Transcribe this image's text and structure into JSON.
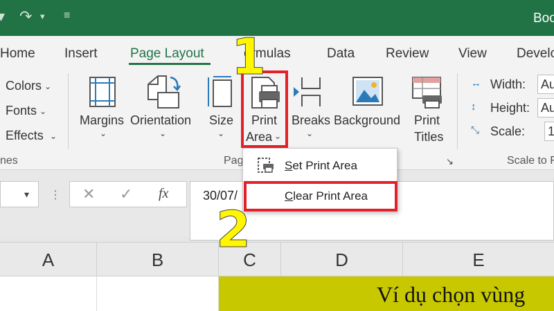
{
  "window": {
    "title": "Boo"
  },
  "tabs": [
    {
      "label": "Home"
    },
    {
      "label": "Insert"
    },
    {
      "label": "Page Layout"
    },
    {
      "label": "ormulas"
    },
    {
      "label": "Data"
    },
    {
      "label": "Review"
    },
    {
      "label": "View"
    },
    {
      "label": "Develo"
    }
  ],
  "ribbon": {
    "themes": {
      "colors": "Colors",
      "fonts": "Fonts",
      "effects": "Effects",
      "group_label": "nes"
    },
    "page_setup": {
      "margins": "Margins",
      "orientation": "Orientation",
      "size": "Size",
      "print_area_line1": "Print",
      "print_area_line2": "Area",
      "breaks": "Breaks",
      "background": "Background",
      "print_titles_line1": "Print",
      "print_titles_line2": "Titles",
      "group_label": "Pag"
    },
    "scale_to_fit": {
      "width_label": "Width:",
      "width_value": "Au",
      "height_label": "Height:",
      "height_value": "Au",
      "scale_label": "Scale:",
      "scale_value": "1",
      "group_label": "Scale to F"
    }
  },
  "menu": {
    "set_print_area": {
      "accel": "S",
      "rest": "et Print Area"
    },
    "clear_print_area": {
      "accel": "C",
      "rest": "lear Print Area"
    }
  },
  "formula_bar": {
    "fx": "fx",
    "value": "30/07/"
  },
  "grid": {
    "columns": [
      "A",
      "B",
      "C",
      "D",
      "E"
    ],
    "cell_text": "Ví dụ chọn vùng"
  },
  "annotations": {
    "step1": "1",
    "step2": "2"
  },
  "colors": {
    "excel_green": "#217346",
    "highlight_red": "#e3202a",
    "step_yellow": "#fff600",
    "cell_fill": "#c8c800"
  }
}
